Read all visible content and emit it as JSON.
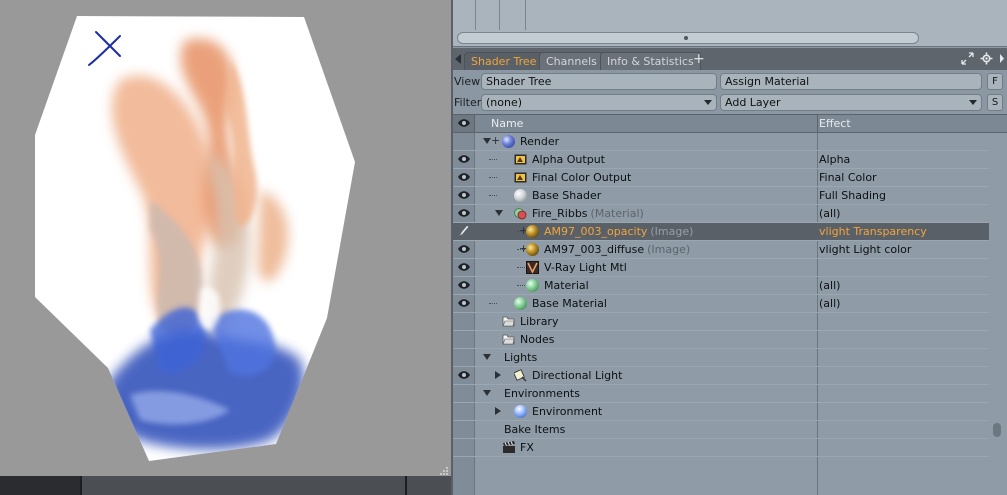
{
  "colors": {
    "accent": "#f2a53a",
    "panel_bg": "#8b98a4",
    "viewport_bg": "#999999",
    "selected_row": "#5a6068"
  },
  "viewport": {
    "marker_icon": "x-marker-icon"
  },
  "tabs": [
    {
      "label": "Shader Tree",
      "active": true
    },
    {
      "label": "Channels",
      "active": false
    },
    {
      "label": "Info & Statistics",
      "active": false
    }
  ],
  "tab_add_label": "+",
  "view_row": {
    "label": "View",
    "value": "Shader Tree",
    "action": "Assign Material",
    "button": "F"
  },
  "filter_row": {
    "label": "Filter",
    "value": "(none)",
    "action": "Add Layer",
    "button": "S"
  },
  "columns": {
    "name": "Name",
    "effect": "Effect"
  },
  "rows": [
    {
      "name": "Render",
      "sub": "",
      "effect": "",
      "eye": false,
      "icon": "render-sphere-icon",
      "expander": "down",
      "plus": true,
      "selected": false
    },
    {
      "name": "Alpha Output",
      "sub": "",
      "effect": "Alpha",
      "eye": true,
      "icon": "output-icon",
      "expander": "",
      "plus": false,
      "selected": false
    },
    {
      "name": "Final Color Output",
      "sub": "",
      "effect": "Final Color",
      "eye": true,
      "icon": "output-icon",
      "expander": "",
      "plus": false,
      "selected": false
    },
    {
      "name": "Base Shader",
      "sub": "",
      "effect": "Full Shading",
      "eye": true,
      "icon": "shader-sphere-icon",
      "expander": "",
      "plus": false,
      "selected": false
    },
    {
      "name": "Fire_Ribbs",
      "sub": "(Material)",
      "effect": "(all)",
      "eye": true,
      "icon": "material-group-icon",
      "expander": "down",
      "plus": false,
      "selected": false
    },
    {
      "name": "AM97_003_opacity",
      "sub": "(Image)",
      "effect": "vlight Transparency",
      "eye": false,
      "icon": "image-sphere-icon",
      "expander": "",
      "plus": true,
      "selected": true
    },
    {
      "name": "AM97_003_diffuse",
      "sub": "(Image)",
      "effect": "vlight Light color",
      "eye": true,
      "icon": "image-sphere-icon",
      "expander": "",
      "plus": true,
      "selected": false
    },
    {
      "name": "V-Ray Light Mtl",
      "sub": "",
      "effect": "",
      "eye": true,
      "icon": "vray-material-icon",
      "expander": "",
      "plus": false,
      "selected": false
    },
    {
      "name": "Material",
      "sub": "",
      "effect": "(all)",
      "eye": true,
      "icon": "material-sphere-icon",
      "expander": "",
      "plus": false,
      "selected": false
    },
    {
      "name": "Base Material",
      "sub": "",
      "effect": "(all)",
      "eye": true,
      "icon": "material-sphere-icon",
      "expander": "",
      "plus": false,
      "selected": false
    },
    {
      "name": "Library",
      "sub": "",
      "effect": "",
      "eye": false,
      "icon": "folder-icon",
      "expander": "",
      "plus": false,
      "selected": false
    },
    {
      "name": "Nodes",
      "sub": "",
      "effect": "",
      "eye": false,
      "icon": "folder-icon",
      "expander": "",
      "plus": false,
      "selected": false
    },
    {
      "name": "Lights",
      "sub": "",
      "effect": "",
      "eye": false,
      "icon": "",
      "expander": "down",
      "plus": false,
      "selected": false
    },
    {
      "name": "Directional Light",
      "sub": "",
      "effect": "",
      "eye": true,
      "icon": "directional-light-icon",
      "expander": "right",
      "plus": false,
      "selected": false
    },
    {
      "name": "Environments",
      "sub": "",
      "effect": "",
      "eye": false,
      "icon": "",
      "expander": "down",
      "plus": false,
      "selected": false
    },
    {
      "name": "Environment",
      "sub": "",
      "effect": "",
      "eye": false,
      "icon": "environment-sphere-icon",
      "expander": "right",
      "plus": false,
      "selected": false
    },
    {
      "name": "Bake Items",
      "sub": "",
      "effect": "",
      "eye": false,
      "icon": "",
      "expander": "",
      "plus": false,
      "selected": false
    },
    {
      "name": "FX",
      "sub": "",
      "effect": "",
      "eye": false,
      "icon": "clapperboard-icon",
      "expander": "",
      "plus": false,
      "selected": false
    }
  ]
}
